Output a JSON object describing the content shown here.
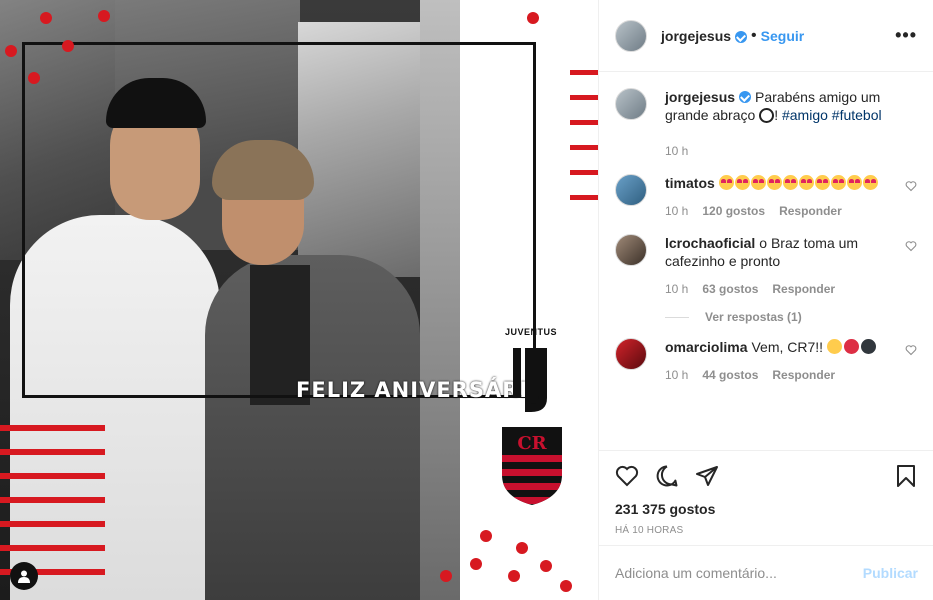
{
  "photo": {
    "overlay_text": "FELIZ ANIVERSÁRIO",
    "juve_text": "JUVENTUS",
    "user_tag_icon": "user-icon",
    "accent": "#d71920"
  },
  "header": {
    "username": "jorgejesus",
    "separator": "•",
    "follow_label": "Seguir",
    "more_icon": "ellipsis-icon"
  },
  "caption": {
    "username": "jorgejesus",
    "text": "Parabéns amigo um grande abraço",
    "after_emoji": "!",
    "tags": [
      "#amigo",
      "#futebol"
    ],
    "time": "10 h"
  },
  "comments": [
    {
      "username": "timatos",
      "emoji_count": 10,
      "time": "10 h",
      "likes": "120 gostos",
      "reply": "Responder"
    },
    {
      "username": "lcrochaoficial",
      "text": "o Braz toma um cafezinho e pronto",
      "time": "10 h",
      "likes": "63 gostos",
      "reply": "Responder",
      "view_replies": "Ver respostas (1)"
    },
    {
      "username": "omarciolima",
      "text": "Vem, CR7!!",
      "time": "10 h",
      "likes": "44 gostos",
      "reply": "Responder"
    }
  ],
  "actions": {
    "likes": "231 375 gostos",
    "time": "HÁ 10 HORAS"
  },
  "add_comment": {
    "placeholder": "Adiciona um comentário...",
    "publish": "Publicar"
  },
  "colors": {
    "link": "#3897f0",
    "hashtag": "#003569",
    "muted": "#8e8e8e",
    "publish_disabled": "#b3dbff"
  }
}
